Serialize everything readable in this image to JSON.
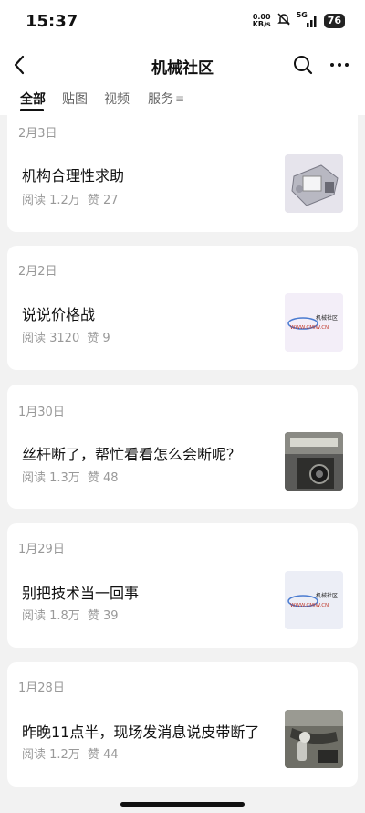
{
  "status_bar": {
    "time": "15:37",
    "net_speed_value": "0.00",
    "net_speed_unit": "KB/s",
    "signal_label": "5G",
    "battery": "76"
  },
  "header": {
    "title": "机械社区",
    "back_icon": "chevron-left-icon",
    "search_icon": "search-icon",
    "more_icon": "more-dots-icon"
  },
  "tabs": [
    {
      "label": "全部",
      "active": true
    },
    {
      "label": "贴图",
      "active": false
    },
    {
      "label": "视频",
      "active": false
    },
    {
      "label": "服务",
      "active": false
    }
  ],
  "posts": [
    {
      "date": "2月3日",
      "title": "机构合理性求助",
      "reads": "阅读 1.2万",
      "likes": "赞 27",
      "thumb": "mechanism-photo"
    },
    {
      "date": "2月2日",
      "title": "说说价格战",
      "reads": "阅读 3120",
      "likes": "赞 9",
      "thumb": "cmiw-logo"
    },
    {
      "date": "1月30日",
      "title": "丝杆断了，帮忙看看怎么会断呢？",
      "reads": "阅读 1.3万",
      "likes": "赞 48",
      "thumb": "leadscrew-photo"
    },
    {
      "date": "1月29日",
      "title": "别把技术当一回事",
      "reads": "阅读 1.8万",
      "likes": "赞 39",
      "thumb": "cmiw-logo"
    },
    {
      "date": "1月28日",
      "title": "昨晚11点半，现场发消息说皮带断了",
      "reads": "阅读 1.2万",
      "likes": "赞 44",
      "thumb": "belt-photo"
    }
  ],
  "logo_text": {
    "cn": "机械社区",
    "en": "WWW.CMIW.CN"
  },
  "colors": {
    "background": "#f2f2f2",
    "card": "#ffffff",
    "meta": "#999999",
    "text": "#111111"
  }
}
